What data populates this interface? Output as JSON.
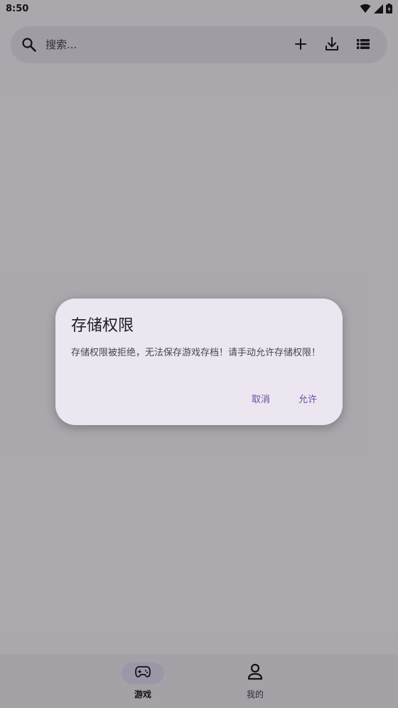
{
  "status_bar": {
    "time": "8:50",
    "icons": [
      "wifi-icon",
      "cellular-signal-icon",
      "battery-charging-icon"
    ]
  },
  "search": {
    "placeholder": "搜索...",
    "value": "",
    "actions": [
      "add-icon",
      "download-icon",
      "list-view-icon"
    ]
  },
  "bottom_nav": {
    "items": [
      {
        "label": "游戏",
        "icon": "gamepad-icon",
        "active": true
      },
      {
        "label": "我的",
        "icon": "person-icon",
        "active": false
      }
    ]
  },
  "dialog": {
    "title": "存储权限",
    "message": "存储权限被拒绝，无法保存游戏存档！请手动允许存储权限！",
    "cancel_label": "取消",
    "allow_label": "允许"
  },
  "colors": {
    "primary": "#6750a4",
    "surface": "#fdf7ff",
    "surface_container": "#ece6f0",
    "nav_background": "#f3edf7",
    "active_indicator": "#e8def8",
    "on_surface": "#1d1b20"
  }
}
